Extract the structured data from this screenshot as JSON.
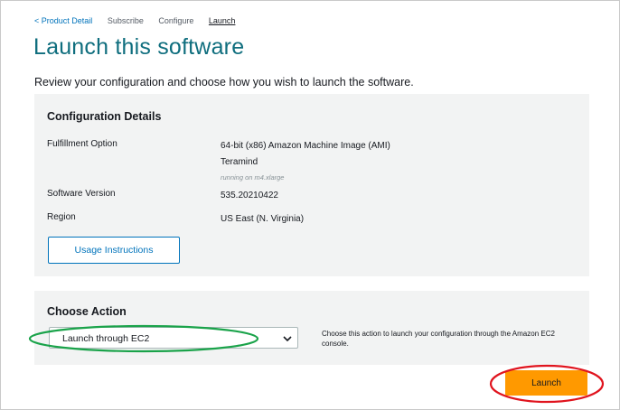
{
  "breadcrumb": {
    "back": "< Product Detail",
    "step_subscribe": "Subscribe",
    "step_configure": "Configure",
    "step_launch": "Launch"
  },
  "page": {
    "title": "Launch this software",
    "subtitle": "Review your configuration and choose how you wish to launch the software."
  },
  "config": {
    "heading": "Configuration Details",
    "fulfillment_label": "Fulfillment Option",
    "fulfillment_value": "64-bit (x86) Amazon Machine Image (AMI)",
    "product_name": "Teramind",
    "instance_note": "running on m4.xlarge",
    "version_label": "Software Version",
    "version_value": "535.20210422",
    "region_label": "Region",
    "region_value": "US East (N. Virginia)",
    "usage_button": "Usage Instructions"
  },
  "action": {
    "heading": "Choose Action",
    "selected": "Launch through EC2",
    "help": "Choose this action to launch your configuration through the Amazon EC2 console."
  },
  "launch_button": "Launch",
  "colors": {
    "title": "#0f6e7e",
    "link": "#0073bb",
    "panel": "#f2f3f3",
    "launch_button": "#ff9900",
    "annotation_green": "#1aa34a",
    "annotation_red": "#e0141e"
  },
  "icons": {
    "select_chevron": "chevron-down-icon"
  }
}
